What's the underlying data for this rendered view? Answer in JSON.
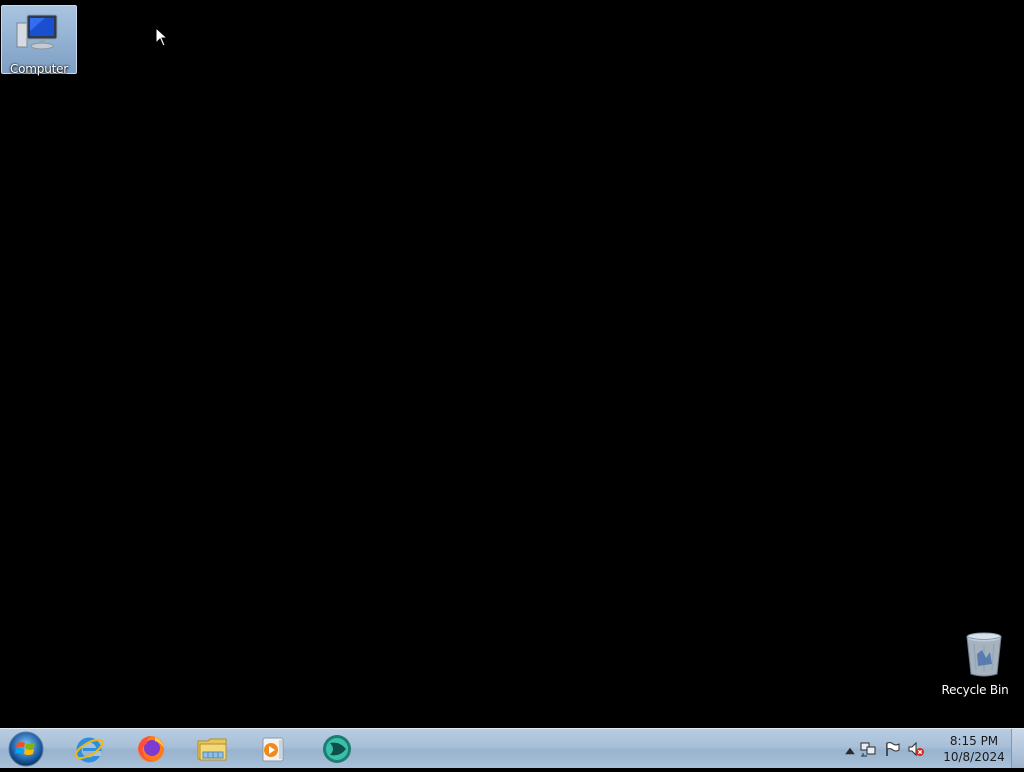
{
  "desktop": {
    "icons": [
      {
        "label": "Computer",
        "icon": "computer-icon"
      },
      {
        "label": "Recycle Bin",
        "icon": "recycle-bin-icon"
      }
    ]
  },
  "taskbar": {
    "start": {
      "icon": "windows-start-orb-icon"
    },
    "pinned": [
      {
        "icon": "internet-explorer-icon"
      },
      {
        "icon": "firefox-icon"
      },
      {
        "icon": "file-explorer-icon"
      },
      {
        "icon": "media-player-icon"
      },
      {
        "icon": "app-icon"
      }
    ],
    "tray": {
      "icons": [
        "show-hidden-icons-arrow-icon",
        "network-icon",
        "action-center-flag-icon",
        "volume-muted-icon"
      ],
      "clock": {
        "time": "8:15 PM",
        "date": "10/8/2024"
      }
    }
  },
  "colors": {
    "desktop_background": "#000000",
    "taskbar": "#a9c1d9",
    "selection": "#7d9fc4"
  }
}
